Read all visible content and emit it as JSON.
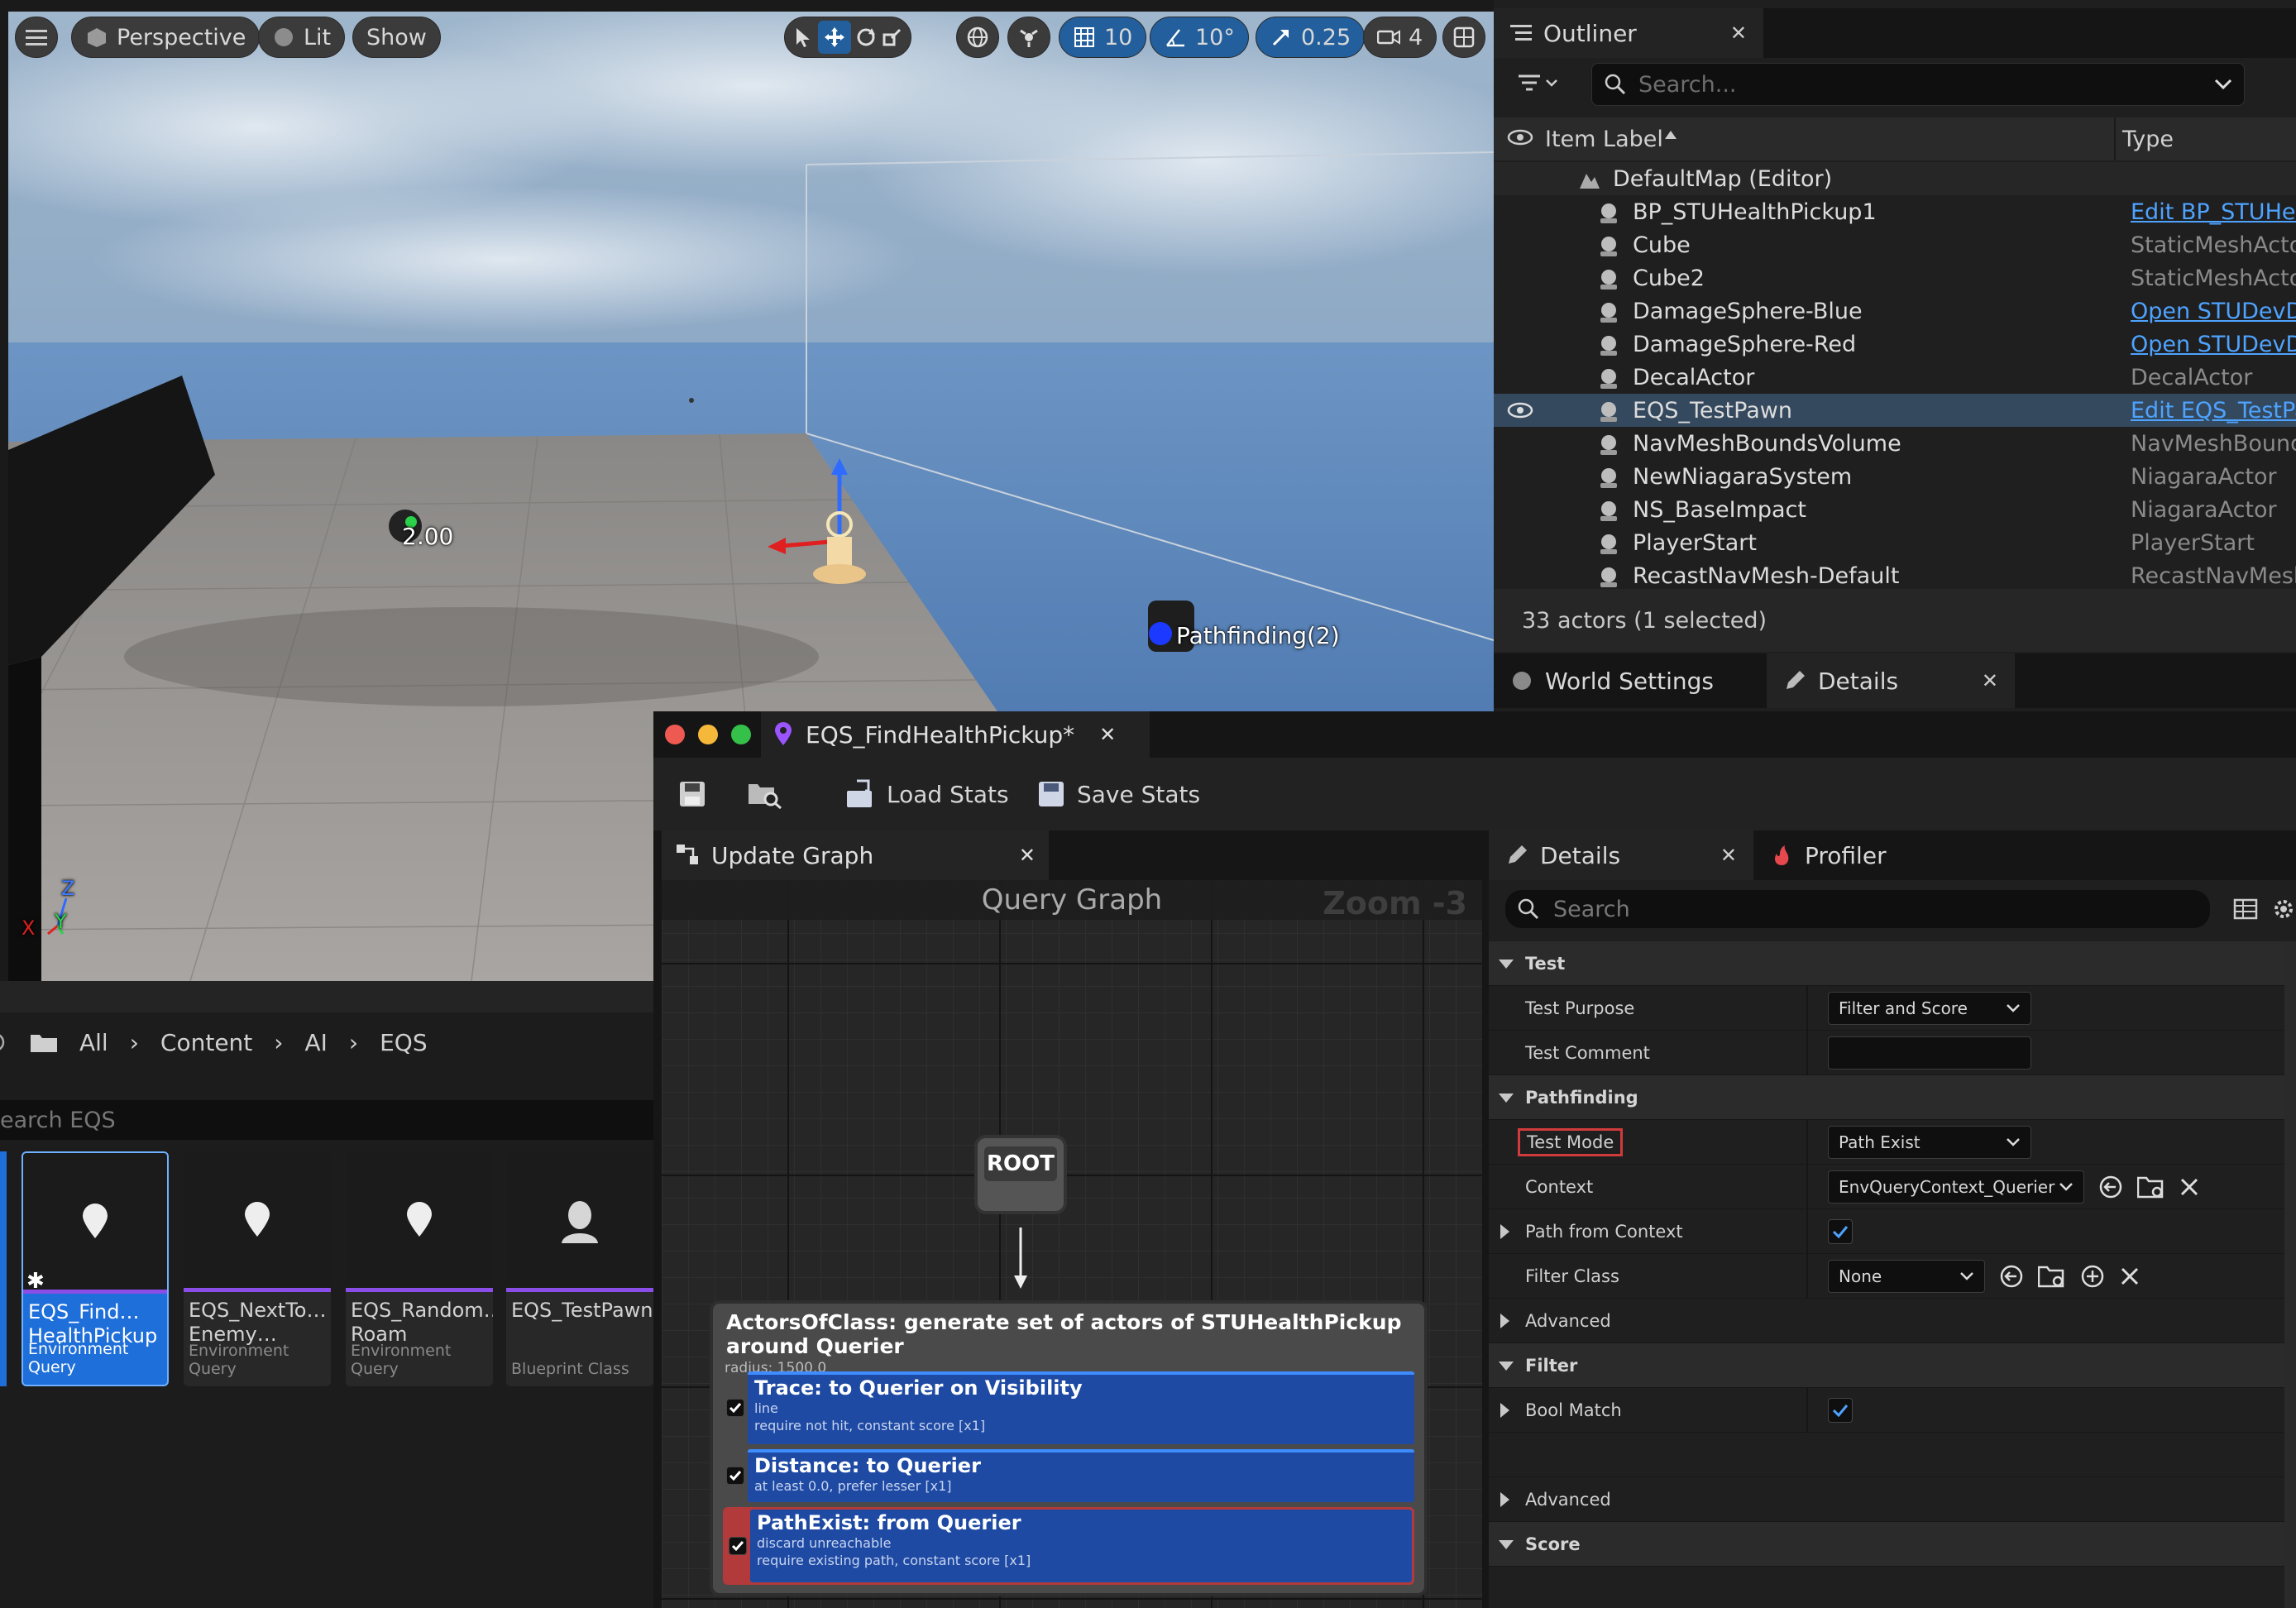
{
  "viewport": {
    "perspective_label": "Perspective",
    "lit_label": "Lit",
    "show_label": "Show",
    "grid_value": "10",
    "angle_value": "10°",
    "scale_value": "0.25",
    "camera_value": "4",
    "actor_label_1": "2.00",
    "actor_label_2": "Pathfinding(2)",
    "axis_z": "Z",
    "axis_x": "X",
    "axis_y": "Y"
  },
  "outliner": {
    "title": "Outliner",
    "search_placeholder": "Search...",
    "col_label": "Item Label",
    "col_type": "Type",
    "root": "DefaultMap (Editor)",
    "rows": [
      {
        "label": "BP_STUHealthPickup1",
        "type": "Edit BP_STUHea",
        "link": true
      },
      {
        "label": "Cube",
        "type": "StaticMeshActor",
        "link": false
      },
      {
        "label": "Cube2",
        "type": "StaticMeshActor",
        "link": false
      },
      {
        "label": "DamageSphere-Blue",
        "type": "Open STUDevDa",
        "link": true
      },
      {
        "label": "DamageSphere-Red",
        "type": "Open STUDevDa",
        "link": true
      },
      {
        "label": "DecalActor",
        "type": "DecalActor",
        "link": false
      },
      {
        "label": "EQS_TestPawn",
        "type": "Edit EQS_TestPa",
        "link": true
      },
      {
        "label": "NavMeshBoundsVolume",
        "type": "NavMeshBounds",
        "link": false
      },
      {
        "label": "NewNiagaraSystem",
        "type": "NiagaraActor",
        "link": false
      },
      {
        "label": "NS_BaseImpact",
        "type": "NiagaraActor",
        "link": false
      },
      {
        "label": "PlayerStart",
        "type": "PlayerStart",
        "link": false
      },
      {
        "label": "RecastNavMesh-Default",
        "type": "RecastNavMesh",
        "link": false
      }
    ],
    "footer": "33 actors (1 selected)",
    "tab_world_settings": "World Settings",
    "tab_details": "Details"
  },
  "content_browser": {
    "crumbs": [
      "All",
      "Content",
      "AI",
      "EQS"
    ],
    "search_placeholder": "earch EQS",
    "assets": [
      {
        "name": "EQS_Find…\nHealthPickup",
        "kind": "Environment Query"
      },
      {
        "name": "EQS_NextTo…\nEnemy…",
        "kind": "Environment Query"
      },
      {
        "name": "EQS_Random…\nRoam",
        "kind": "Environment Query"
      },
      {
        "name": "EQS_TestPawn",
        "kind": "Blueprint Class"
      }
    ]
  },
  "eqs": {
    "window_title": "EQS_FindHealthPickup*",
    "load_stats": "Load Stats",
    "save_stats": "Save Stats",
    "graph_tab": "Update Graph",
    "graph_title": "Query Graph",
    "zoom": "Zoom -3",
    "root_label": "ROOT",
    "node_title": "ActorsOfClass: generate set of actors of STUHealthPickup around Querier",
    "node_sub": "radius: 1500.0",
    "tests": [
      {
        "title": "Trace: to Querier on Visibility",
        "line1": "line",
        "line2": "require not hit, constant score [x1]"
      },
      {
        "title": "Distance: to Querier",
        "line1": "at least 0.0, prefer lesser [x1]",
        "line2": ""
      },
      {
        "title": "PathExist: from Querier",
        "line1": "discard unreachable",
        "line2": "require existing path, constant score [x1]"
      }
    ]
  },
  "details": {
    "tab": "Details",
    "tab_profiler": "Profiler",
    "search_placeholder": "Search",
    "cat_test": "Test",
    "test_purpose_label": "Test Purpose",
    "test_purpose_value": "Filter and Score",
    "test_comment_label": "Test Comment",
    "cat_pathfinding": "Pathfinding",
    "test_mode_label": "Test Mode",
    "test_mode_value": "Path Exist",
    "context_label": "Context",
    "context_value": "EnvQueryContext_Querier",
    "path_from_context_label": "Path from Context",
    "filter_class_label": "Filter Class",
    "filter_class_value": "None",
    "advanced_label": "Advanced",
    "cat_filter": "Filter",
    "bool_match_label": "Bool Match",
    "advanced2_label": "Advanced",
    "cat_score": "Score"
  },
  "colors": {
    "accent": "#1e6fd9",
    "node_blue": "#1e4aa3",
    "error_red": "#d23b3b",
    "link_blue": "#4ea3ff"
  }
}
